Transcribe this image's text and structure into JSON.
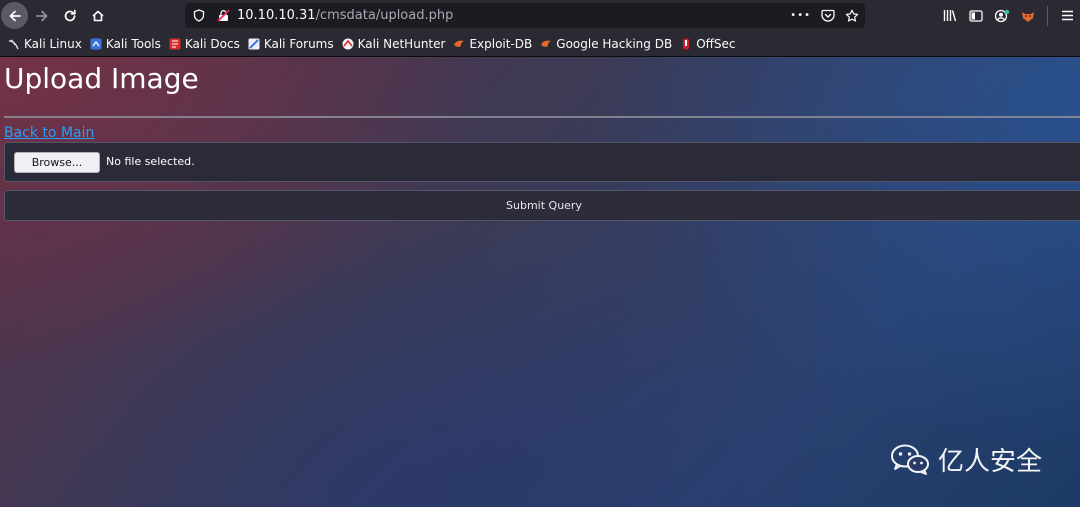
{
  "toolbar": {
    "url_host": "10.10.10.31",
    "url_path": "/cmsdata/upload.php",
    "overflow_label": "•••"
  },
  "bookmarks": [
    {
      "label": "Kali Linux",
      "icon": "kali-dragon-icon"
    },
    {
      "label": "Kali Tools",
      "icon": "kali-tools-icon"
    },
    {
      "label": "Kali Docs",
      "icon": "kali-docs-icon"
    },
    {
      "label": "Kali Forums",
      "icon": "kali-forums-icon"
    },
    {
      "label": "Kali NetHunter",
      "icon": "nethunter-icon"
    },
    {
      "label": "Exploit-DB",
      "icon": "exploit-db-icon"
    },
    {
      "label": "Google Hacking DB",
      "icon": "ghdb-icon"
    },
    {
      "label": "OffSec",
      "icon": "offsec-icon"
    }
  ],
  "page": {
    "title": "Upload Image",
    "back_link": "Back to Main",
    "browse_label": "Browse...",
    "file_status": "No file selected.",
    "submit_label": "Submit Query"
  },
  "watermark": {
    "text": "亿人安全"
  },
  "colors": {
    "link": "#2a9df4",
    "chrome": "#2b2a33",
    "urlbar": "#1c1b22"
  }
}
